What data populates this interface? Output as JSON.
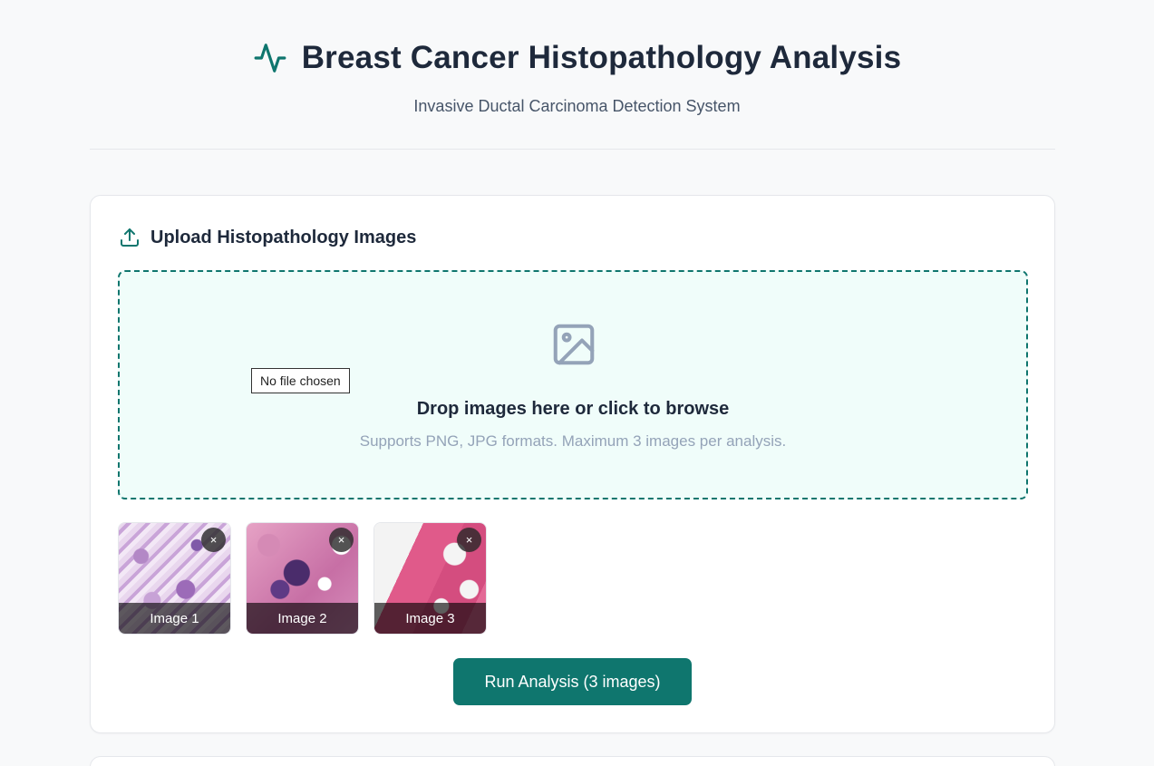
{
  "header": {
    "title": "Breast Cancer Histopathology Analysis",
    "subtitle": "Invasive Ductal Carcinoma Detection System",
    "icon": "pulse-icon"
  },
  "upload": {
    "title": "Upload Histopathology Images",
    "icon": "upload-icon",
    "dropzone": {
      "icon": "image-icon",
      "file_chip": "No file chosen",
      "title": "Drop images here or click to browse",
      "hint": "Supports PNG, JPG formats. Maximum 3 images per analysis."
    },
    "images": [
      {
        "label": "Image 1",
        "close": "×"
      },
      {
        "label": "Image 2",
        "close": "×"
      },
      {
        "label": "Image 3",
        "close": "×"
      }
    ],
    "run_button": "Run Analysis (3 images)"
  },
  "colors": {
    "accent": "#0f766e",
    "dropzone_bg": "#f0fdfa",
    "page_bg": "#f8f9fa"
  }
}
